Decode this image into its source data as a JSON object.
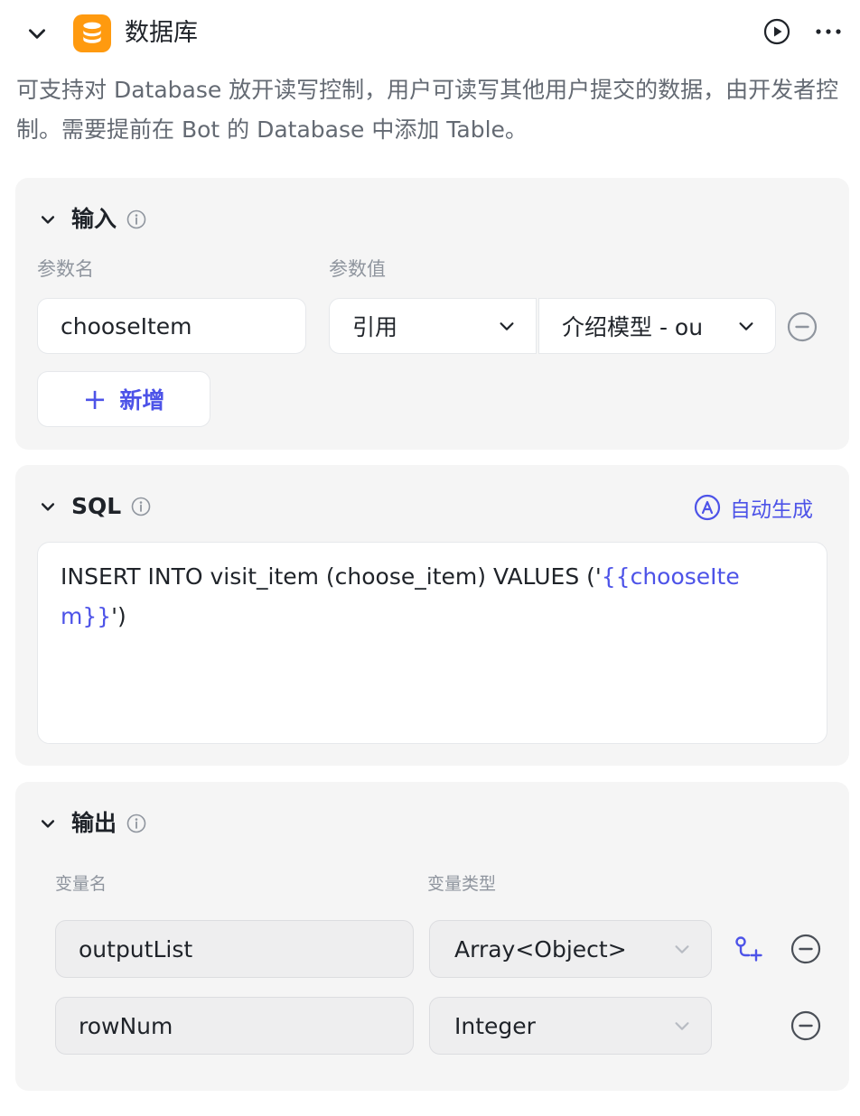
{
  "header": {
    "title": "数据库",
    "description": "可支持对 Database 放开读写控制，用户可读写其他用户提交的数据，由开发者控制。需要提前在 Bot 的 Database 中添加 Table。",
    "icon_color": "#ff9a0f"
  },
  "input_section": {
    "title": "输入",
    "col_param_name": "参数名",
    "col_param_value": "参数值",
    "params": [
      {
        "name": "chooseItem",
        "value_type": "引用",
        "value_ref": "介绍模型 - ou"
      }
    ],
    "add_label": "新增",
    "add_plus": "+"
  },
  "sql_section": {
    "title": "SQL",
    "auto_generate_label": "自动生成",
    "sql_prefix": "INSERT INTO visit_item (choose_item) VALUES ('",
    "sql_variable": "{{chooseItem}}",
    "sql_suffix": "')"
  },
  "output_section": {
    "title": "输出",
    "col_var_name": "变量名",
    "col_var_type": "变量类型",
    "outputs": [
      {
        "name": "outputList",
        "type": "Array<Object>"
      },
      {
        "name": "rowNum",
        "type": "Integer"
      }
    ]
  },
  "colors": {
    "accent": "#4d53e8",
    "section_bg": "#f5f5f5",
    "muted_text": "#8f959e"
  }
}
